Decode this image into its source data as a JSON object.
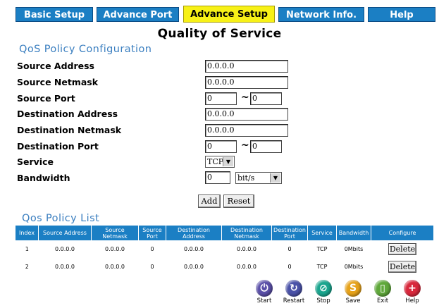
{
  "tabs": [
    {
      "label": "Basic Setup",
      "active": false
    },
    {
      "label": "Advance Port",
      "active": false
    },
    {
      "label": "Advance Setup",
      "active": true
    },
    {
      "label": "Network Info.",
      "active": false
    },
    {
      "label": "Help",
      "active": false
    }
  ],
  "page_title": "Quality of Service",
  "config": {
    "heading": "QoS Policy Configuration",
    "source_address": {
      "label": "Source Address",
      "value": "0.0.0.0"
    },
    "source_netmask": {
      "label": "Source Netmask",
      "value": "0.0.0.0"
    },
    "source_port": {
      "label": "Source Port",
      "from": "0",
      "to": "0",
      "sep": "~"
    },
    "dest_address": {
      "label": "Destination Address",
      "value": "0.0.0.0"
    },
    "dest_netmask": {
      "label": "Destination Netmask",
      "value": "0.0.0.0"
    },
    "dest_port": {
      "label": "Destination Port",
      "from": "0",
      "to": "0",
      "sep": "~"
    },
    "service": {
      "label": "Service",
      "value": "TCP"
    },
    "bandwidth": {
      "label": "Bandwidth",
      "value": "0",
      "unit": "bit/s"
    },
    "add_label": "Add",
    "reset_label": "Reset"
  },
  "list": {
    "heading": "Qos Policy List",
    "columns": [
      "Index",
      "Source Address",
      "Source Netmask",
      "Source Port",
      "Destination Address",
      "Destination Netmask",
      "Destination Port",
      "Service",
      "Bandwidth",
      "Configure"
    ],
    "rows": [
      {
        "index": "1",
        "src_addr": "0.0.0.0",
        "src_mask": "0.0.0.0",
        "src_port": "0",
        "dst_addr": "0.0.0.0",
        "dst_mask": "0.0.0.0",
        "dst_port": "0",
        "service": "TCP",
        "bandwidth": "0Mbits",
        "action": "Delete"
      },
      {
        "index": "2",
        "src_addr": "0.0.0.0",
        "src_mask": "0.0.0.0",
        "src_port": "0",
        "dst_addr": "0.0.0.0",
        "dst_mask": "0.0.0.0",
        "dst_port": "0",
        "service": "TCP",
        "bandwidth": "0Mbits",
        "action": "Delete"
      }
    ]
  },
  "toolbar": [
    {
      "label": "Start",
      "icon": "power-icon",
      "color": "#5a4fa8"
    },
    {
      "label": "Restart",
      "icon": "restart-icon",
      "color": "#4a52a8"
    },
    {
      "label": "Stop",
      "icon": "stop-icon",
      "color": "#1aa58e"
    },
    {
      "label": "Save",
      "icon": "save-icon",
      "color": "#e6a21a"
    },
    {
      "label": "Exit",
      "icon": "exit-icon",
      "color": "#5fa83a"
    },
    {
      "label": "Help",
      "icon": "help-icon",
      "color": "#d8283c"
    }
  ],
  "colors": {
    "tab_bg": "#1b7fc4",
    "tab_active_bg": "#f7f117",
    "heading": "#3b7fc0"
  }
}
